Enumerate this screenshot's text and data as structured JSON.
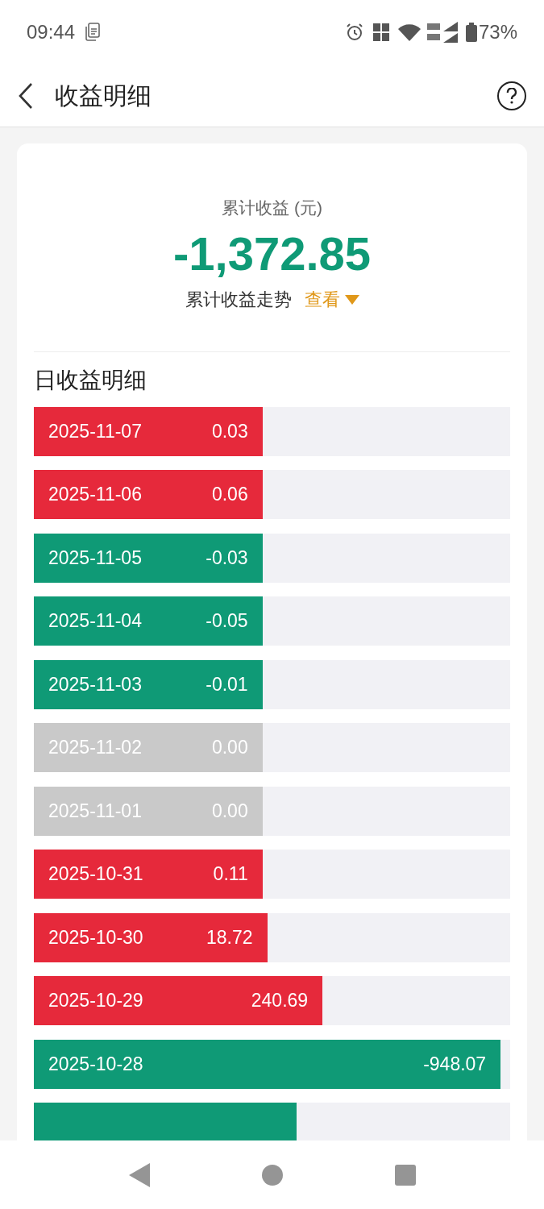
{
  "status_bar": {
    "time": "09:44",
    "battery": "73%"
  },
  "header": {
    "title": "收益明细"
  },
  "summary": {
    "label": "累计收益 (元)",
    "value": "-1,372.85",
    "color": "#0f9a76",
    "trend_label": "累计收益走势",
    "trend_link": "查看"
  },
  "daily": {
    "title": "日收益明细",
    "rows": [
      {
        "date": "2025-11-07",
        "amount": "0.03",
        "color": "#e6293b",
        "level": 0.48
      },
      {
        "date": "2025-11-06",
        "amount": "0.06",
        "color": "#e6293b",
        "level": 0.48
      },
      {
        "date": "2025-11-05",
        "amount": "-0.03",
        "color": "#0f9a76",
        "level": 0.48
      },
      {
        "date": "2025-11-04",
        "amount": "-0.05",
        "color": "#0f9a76",
        "level": 0.48
      },
      {
        "date": "2025-11-03",
        "amount": "-0.01",
        "color": "#0f9a76",
        "level": 0.48
      },
      {
        "date": "2025-11-02",
        "amount": "0.00",
        "color": "#c9c9c9",
        "level": 0.48
      },
      {
        "date": "2025-11-01",
        "amount": "0.00",
        "color": "#c9c9c9",
        "level": 0.48
      },
      {
        "date": "2025-10-31",
        "amount": "0.11",
        "color": "#e6293b",
        "level": 0.48
      },
      {
        "date": "2025-10-30",
        "amount": "18.72",
        "color": "#e6293b",
        "level": 0.49
      },
      {
        "date": "2025-10-29",
        "amount": "240.69",
        "color": "#e6293b",
        "level": 0.606
      },
      {
        "date": "2025-10-28",
        "amount": "-948.07",
        "color": "#0f9a76",
        "level": 0.98
      },
      {
        "color": "#0f9a76",
        "level": 0.551
      }
    ]
  }
}
